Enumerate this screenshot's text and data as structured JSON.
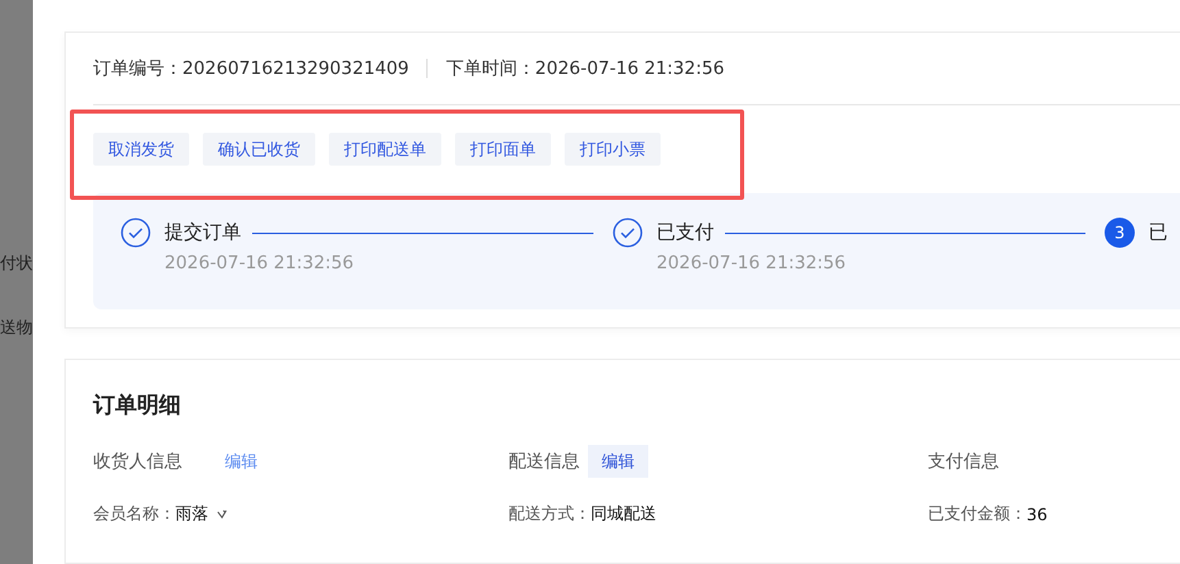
{
  "backdrop": {
    "texts": [
      "付状",
      "送物"
    ]
  },
  "order": {
    "number_label": "订单编号：",
    "number": "20260716213290321409",
    "time_label": "下单时间：",
    "time": "2026-07-16 21:32:56",
    "actions": [
      "取消发货",
      "确认已收货",
      "打印配送单",
      "打印面单",
      "打印小票"
    ],
    "steps": [
      {
        "kind": "done",
        "label": "提交订单",
        "time": "2026-07-16 21:32:56"
      },
      {
        "kind": "done",
        "label": "已支付",
        "time": "2026-07-16 21:32:56"
      },
      {
        "kind": "current",
        "number": "3",
        "label": "已"
      }
    ]
  },
  "details": {
    "title": "订单明细",
    "sections": [
      {
        "title": "收货人信息",
        "edit": {
          "label": "编辑",
          "highlighted": false
        },
        "fields": [
          {
            "label": "会员名称：",
            "value": "雨落",
            "kind": "member"
          }
        ]
      },
      {
        "title": "配送信息",
        "edit": {
          "label": "编辑",
          "highlighted": true
        },
        "fields": [
          {
            "label": "配送方式：",
            "value": "同城配送",
            "kind": "plain"
          }
        ]
      },
      {
        "title": "支付信息",
        "fields": [
          {
            "label": "已支付金额：",
            "value": "36",
            "kind": "plain"
          }
        ]
      }
    ]
  }
}
